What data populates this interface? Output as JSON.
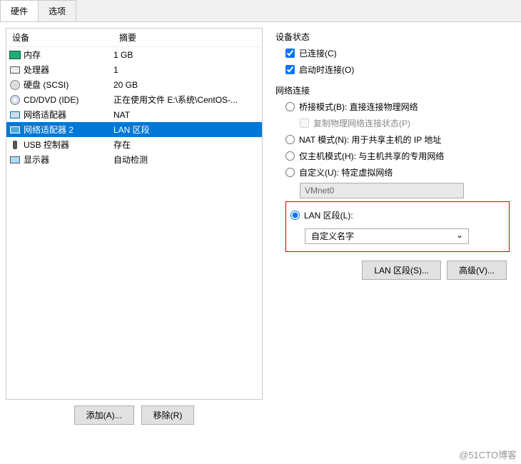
{
  "tabs": {
    "hardware": "硬件",
    "options": "选项"
  },
  "headers": {
    "device": "设备",
    "summary": "摘要"
  },
  "devices": [
    {
      "key": "memory",
      "name": "内存",
      "summary": "1 GB"
    },
    {
      "key": "cpu",
      "name": "处理器",
      "summary": "1"
    },
    {
      "key": "hdd",
      "name": "硬盘 (SCSI)",
      "summary": "20 GB"
    },
    {
      "key": "cd",
      "name": "CD/DVD (IDE)",
      "summary": "正在使用文件 E:\\系统\\CentOS-..."
    },
    {
      "key": "net1",
      "name": "网络适配器",
      "summary": "NAT"
    },
    {
      "key": "net2",
      "name": "网络适配器 2",
      "summary": "LAN 区段"
    },
    {
      "key": "usb",
      "name": "USB 控制器",
      "summary": "存在"
    },
    {
      "key": "display",
      "name": "显示器",
      "summary": "自动检测"
    }
  ],
  "buttons": {
    "add": "添加(A)...",
    "remove": "移除(R)",
    "lan_segments": "LAN 区段(S)...",
    "advanced": "高级(V)..."
  },
  "device_status": {
    "title": "设备状态",
    "connected": "已连接(C)",
    "connect_at_power_on": "启动时连接(O)"
  },
  "network": {
    "title": "网络连接",
    "bridged": "桥接模式(B): 直接连接物理网络",
    "replicate": "复制物理网络连接状态(P)",
    "nat": "NAT 模式(N): 用于共享主机的 IP 地址",
    "hostonly": "仅主机模式(H): 与主机共享的专用网络",
    "custom": "自定义(U): 特定虚拟网络",
    "custom_value": "VMnet0",
    "lan_segment": "LAN 区段(L):",
    "lan_value": "自定义名字"
  },
  "watermark": "@51CTO博客"
}
